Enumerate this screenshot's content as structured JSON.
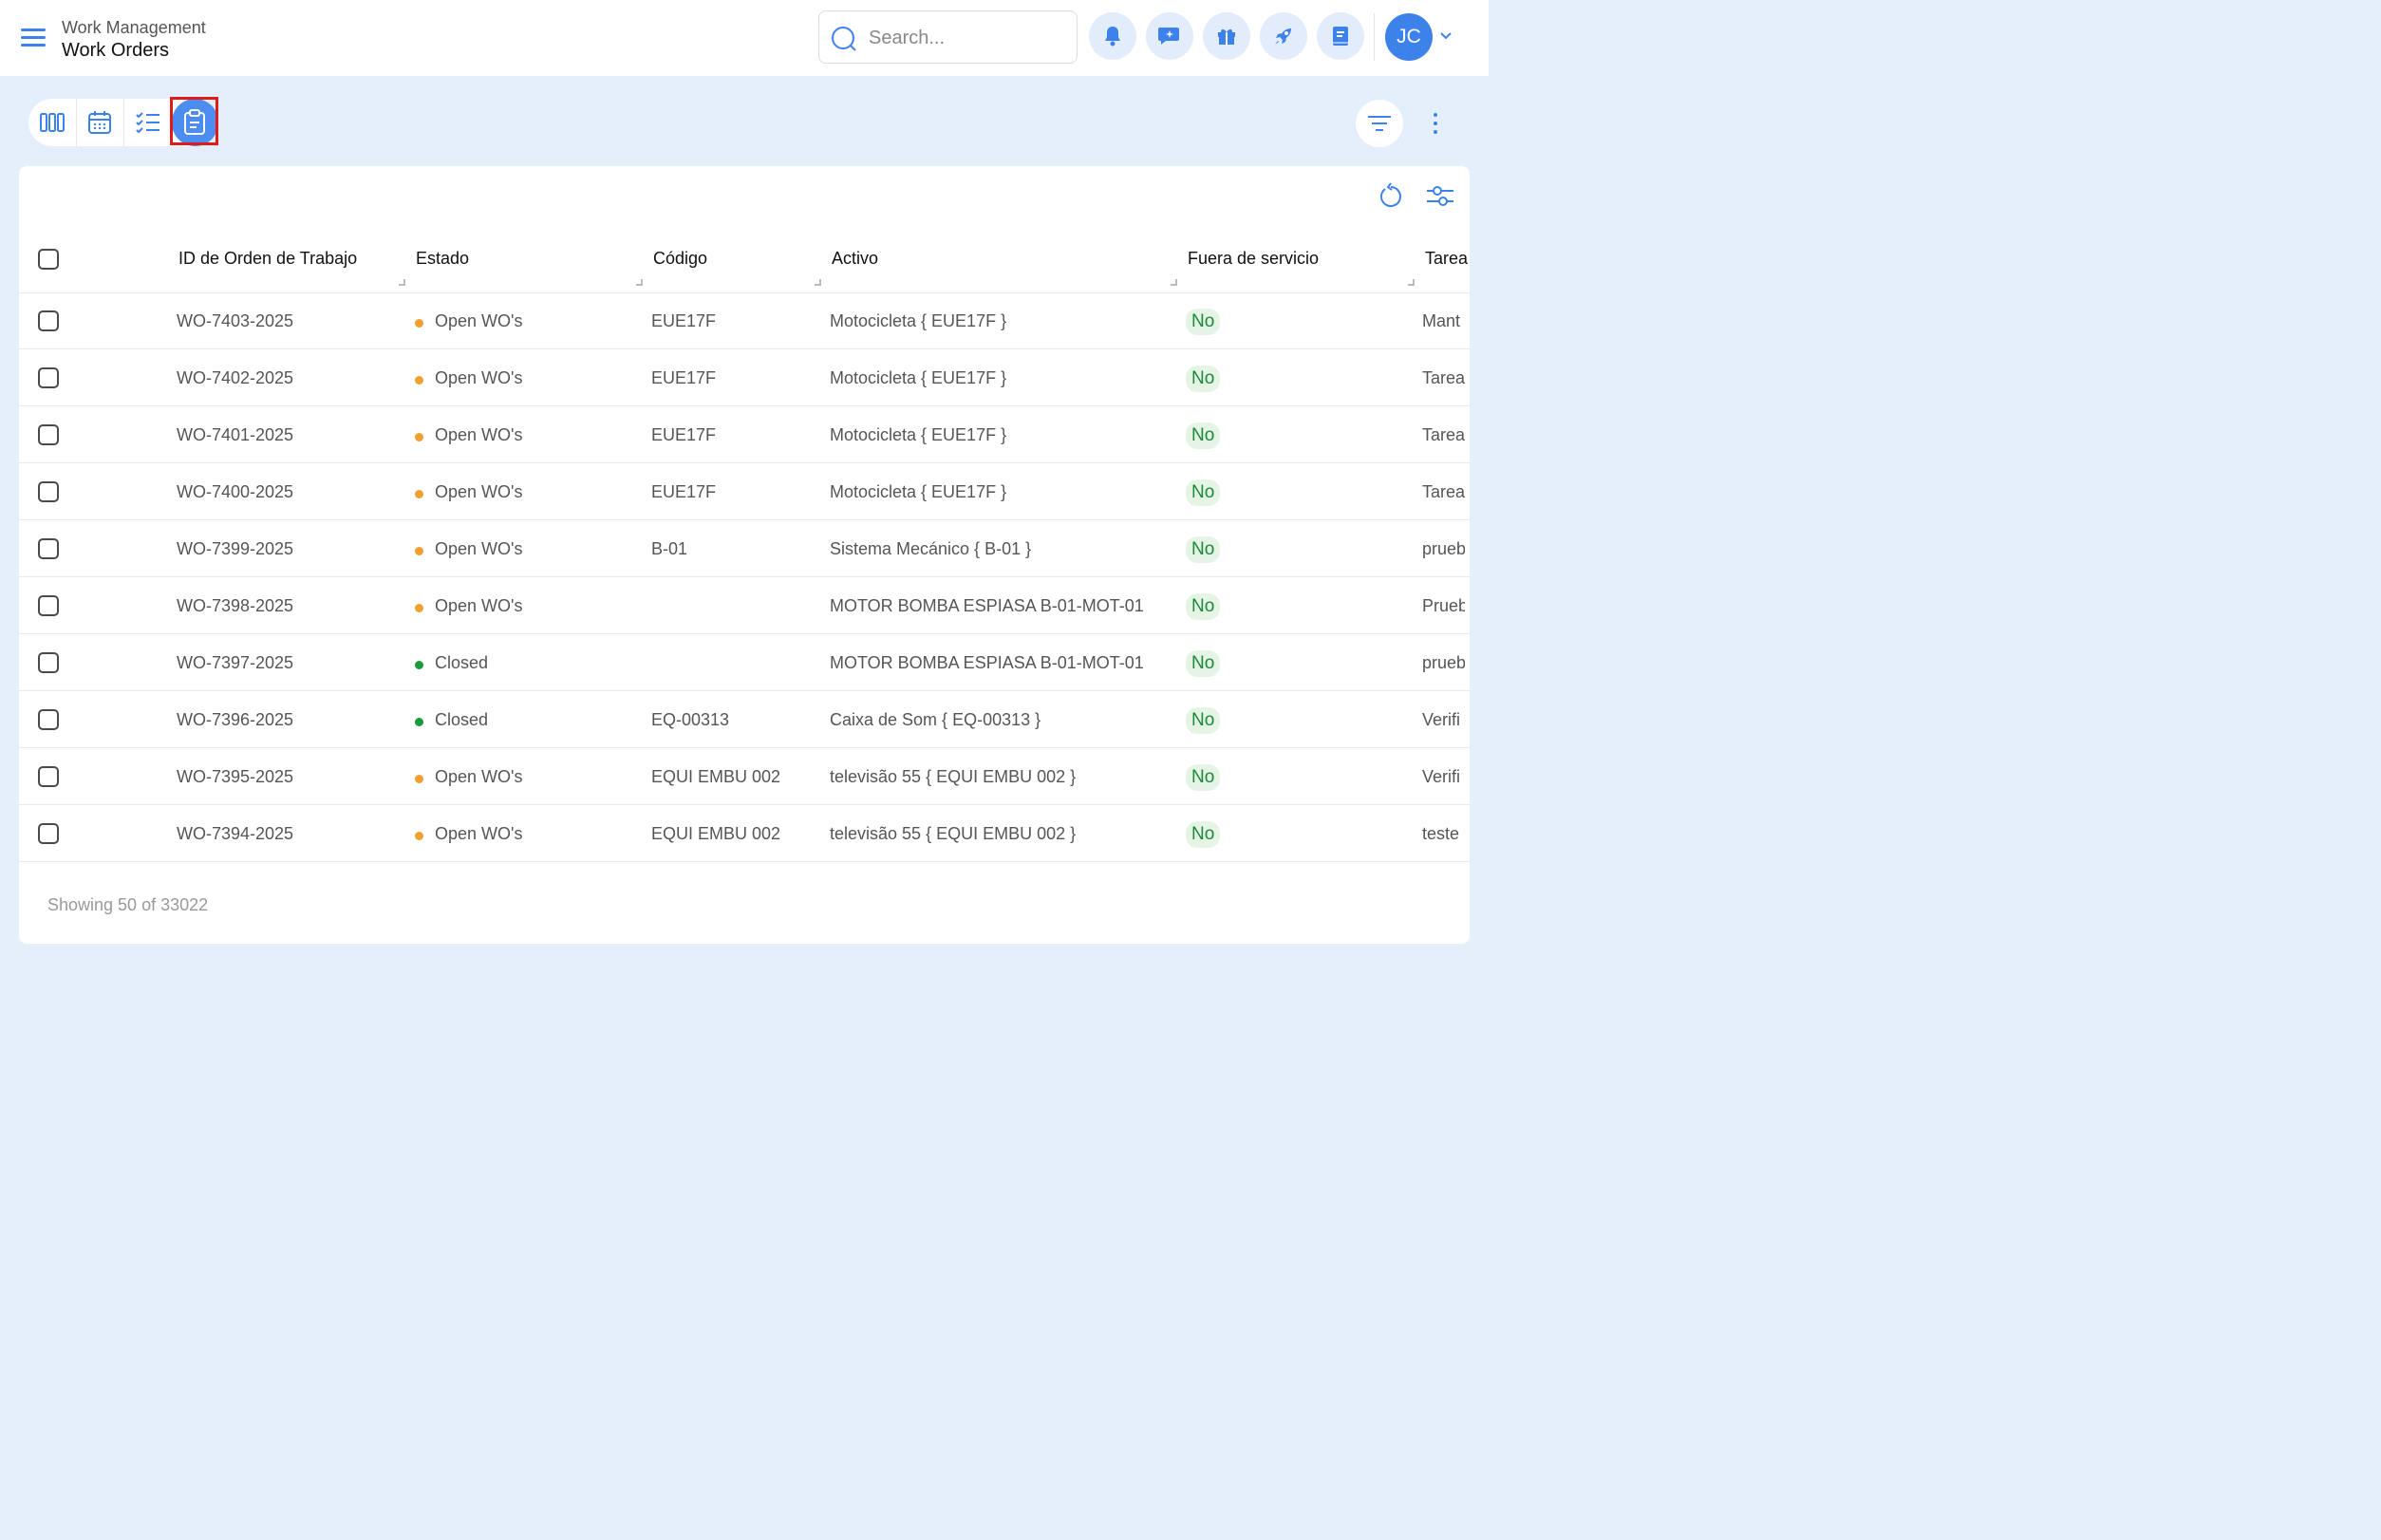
{
  "header": {
    "section": "Work Management",
    "title": "Work Orders",
    "search_placeholder": "Search...",
    "avatar_initials": "JC"
  },
  "colors": {
    "accent": "#3d82ea",
    "open_status": "#f0a030",
    "closed_status": "#1a9a3a",
    "badge_bg": "#e6f4e6",
    "badge_text": "#1a8a3a"
  },
  "views": [
    "board-view",
    "calendar-view",
    "list-view",
    "form-view"
  ],
  "table": {
    "columns": [
      "ID de Orden de Trabajo",
      "Estado",
      "Código",
      "Activo",
      "Fuera de servicio",
      "Tarea"
    ],
    "rows": [
      {
        "id": "WO-7403-2025",
        "status": "Open WO's",
        "status_type": "open",
        "code": "EUE17F",
        "asset": "Motocicleta { EUE17F }",
        "out": "No",
        "task": "Mant"
      },
      {
        "id": "WO-7402-2025",
        "status": "Open WO's",
        "status_type": "open",
        "code": "EUE17F",
        "asset": "Motocicleta { EUE17F }",
        "out": "No",
        "task": "Tarea"
      },
      {
        "id": "WO-7401-2025",
        "status": "Open WO's",
        "status_type": "open",
        "code": "EUE17F",
        "asset": "Motocicleta { EUE17F }",
        "out": "No",
        "task": "Tarea"
      },
      {
        "id": "WO-7400-2025",
        "status": "Open WO's",
        "status_type": "open",
        "code": "EUE17F",
        "asset": "Motocicleta { EUE17F }",
        "out": "No",
        "task": "Tarea"
      },
      {
        "id": "WO-7399-2025",
        "status": "Open WO's",
        "status_type": "open",
        "code": "B-01",
        "asset": "Sistema Mecánico { B-01 }",
        "out": "No",
        "task": "prueb"
      },
      {
        "id": "WO-7398-2025",
        "status": "Open WO's",
        "status_type": "open",
        "code": "",
        "asset": "MOTOR BOMBA ESPIASA B-01-MOT-01",
        "out": "No",
        "task": "Prueb"
      },
      {
        "id": "WO-7397-2025",
        "status": "Closed",
        "status_type": "closed",
        "code": "",
        "asset": "MOTOR BOMBA ESPIASA B-01-MOT-01",
        "out": "No",
        "task": "prueb"
      },
      {
        "id": "WO-7396-2025",
        "status": "Closed",
        "status_type": "closed",
        "code": "EQ-00313",
        "asset": "Caixa de Som { EQ-00313 }",
        "out": "No",
        "task": "Verifi"
      },
      {
        "id": "WO-7395-2025",
        "status": "Open WO's",
        "status_type": "open",
        "code": "EQUI EMBU 002",
        "asset": "televisão 55 { EQUI EMBU 002 }",
        "out": "No",
        "task": "Verifi"
      },
      {
        "id": "WO-7394-2025",
        "status": "Open WO's",
        "status_type": "open",
        "code": "EQUI EMBU 002",
        "asset": "televisão 55 { EQUI EMBU 002 }",
        "out": "No",
        "task": "teste"
      }
    ]
  },
  "footer": {
    "showing": "Showing 50 of 33022"
  }
}
